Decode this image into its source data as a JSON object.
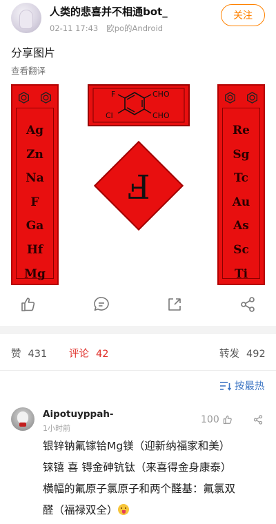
{
  "post": {
    "author": "人类的悲喜并不相通bot_",
    "date": "02-11 17:43",
    "device": "欧po的Android",
    "follow_label": "关注",
    "text": "分享图片",
    "translate_label": "查看翻译"
  },
  "image": {
    "left_couplet": [
      "Ag",
      "Zn",
      "Na",
      "F",
      "Ga",
      "Hf",
      "Mg"
    ],
    "right_couplet": [
      "Re",
      "Sg",
      "Tc",
      "Au",
      "As",
      "Sc",
      "Ti"
    ],
    "banner_labels": {
      "f": "F",
      "cl": "Cl",
      "cho_top": "CHO",
      "cho_bottom": "CHO"
    },
    "center_glyph": "F",
    "colors": {
      "paper_red": "#e80f0f",
      "ink": "#2a0000"
    }
  },
  "actions": {
    "icons": [
      "thumbs-up-icon",
      "comment-icon",
      "repost-icon",
      "share-icon"
    ]
  },
  "stats": {
    "likes_label": "赞",
    "likes_count": "431",
    "comments_label": "评论",
    "comments_count": "42",
    "reposts_label": "转发",
    "reposts_count": "492",
    "active_color": "#e0312b"
  },
  "sort": {
    "label": "按最热",
    "accent": "#3f77c4"
  },
  "comments": [
    {
      "author": "Aipotuyppah-",
      "time": "1小时前",
      "likes": "100",
      "lines": [
        "银锌钠氟镓铪Mg镁（迎新纳福家和美）",
        "铼𬭳 喜 锝金砷钪钛（来喜得金身康泰）",
        "横幅的氟原子氯原子和两个醛基：氟氯双",
        "醛（福禄双全）"
      ]
    }
  ]
}
